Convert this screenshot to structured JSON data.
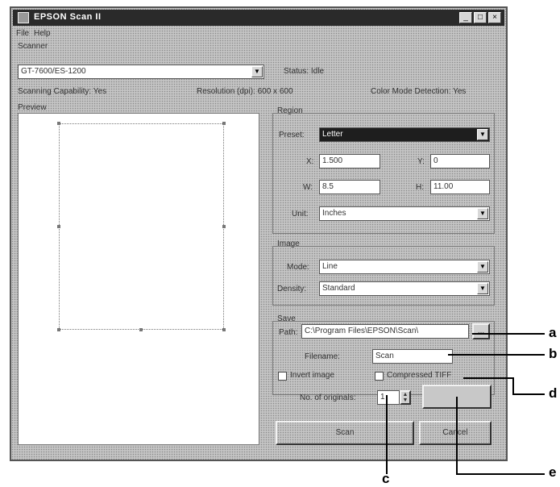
{
  "window": {
    "title": "EPSON Scan II"
  },
  "menu": {
    "file": "File",
    "help": "Help"
  },
  "scanner": {
    "group_label": "Scanner",
    "selected": "GT-7600/ES-1200",
    "status_label": "Status: Idle",
    "scanning_capability": "Scanning Capability: Yes",
    "resolution": "Resolution (dpi): 600 x 600",
    "color_mode_detection": "Color Mode Detection: Yes"
  },
  "preview": {
    "label": "Preview"
  },
  "region": {
    "label": "Region",
    "preset_label": "Preset:",
    "preset_value": "Letter",
    "x_label": "X:",
    "x_value": "1.500",
    "y_label": "Y:",
    "y_value": "0",
    "w_label": "W:",
    "w_value": "8.5",
    "h_label": "H:",
    "h_value": "11.00",
    "unit_label": "Unit:",
    "unit_value": "Inches"
  },
  "image": {
    "label": "Image",
    "mode_label": "Mode:",
    "mode_value": "Line",
    "density_label": "Density:",
    "density_value": "Standard"
  },
  "save": {
    "label": "Save",
    "path_label": "Path:",
    "path_value": "C:\\Program Files\\EPSON\\Scan\\",
    "browse_label": "...",
    "filename_label": "Filename:",
    "filename_value": "Scan",
    "invert_label": "Invert image",
    "compressed_label": "Compressed TIFF",
    "originals_label": "No. of originals:",
    "originals_value": "1",
    "extra_button_label": ""
  },
  "buttons": {
    "scan": "Scan",
    "cancel": "Cancel"
  },
  "callouts": {
    "a": "a",
    "b": "b",
    "c": "c",
    "d": "d",
    "e": "e"
  }
}
